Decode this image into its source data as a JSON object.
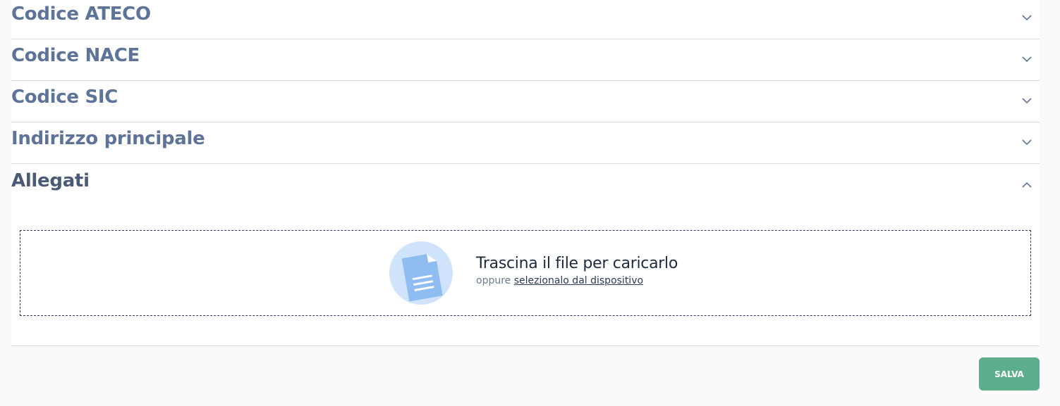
{
  "accordion": {
    "items": [
      {
        "label": "Codice ATECO",
        "state": "collapsed",
        "icon": "chevron-down-icon"
      },
      {
        "label": "Codice NACE",
        "state": "collapsed",
        "icon": "chevron-down-icon"
      },
      {
        "label": "Codice SIC",
        "state": "collapsed",
        "icon": "chevron-down-icon"
      },
      {
        "label": "Indirizzo principale",
        "state": "collapsed",
        "icon": "chevron-down-icon"
      },
      {
        "label": "Allegati",
        "state": "expanded",
        "icon": "chevron-up-icon"
      }
    ]
  },
  "upload": {
    "icon": "document-file-icon",
    "main_text": "Trascina il file per caricarlo",
    "or_text": "oppure",
    "link_text": "selezionalo dal dispositivo"
  },
  "actions": {
    "save_label": "SALVA"
  },
  "colors": {
    "title": "#5e7399",
    "save_button": "#5cae8d",
    "icon_circle": "#cfe3fb",
    "icon_doc": "#8fbcf1"
  }
}
